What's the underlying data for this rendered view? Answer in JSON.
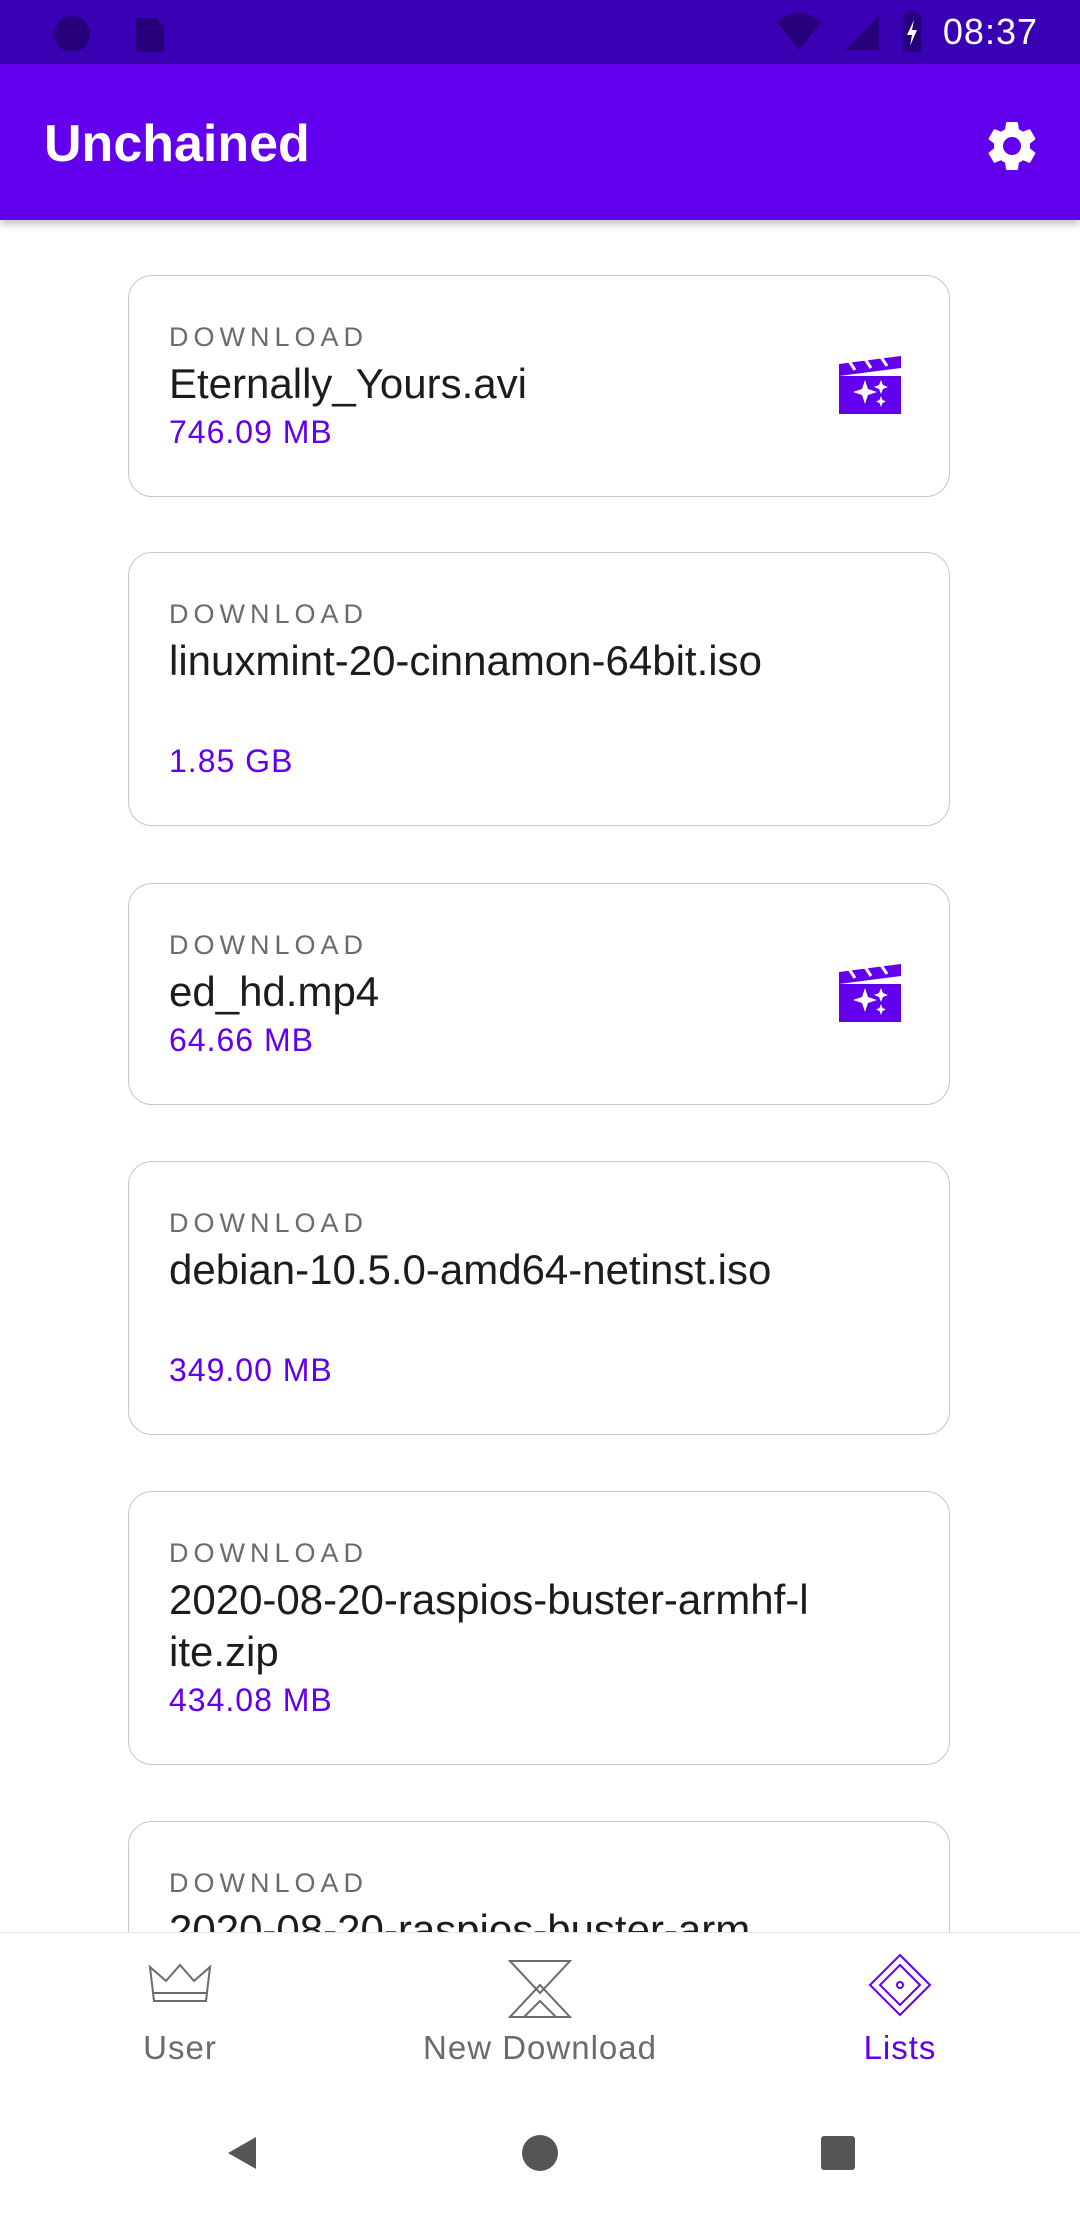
{
  "status_bar": {
    "time": "08:37"
  },
  "app_bar": {
    "title": "Unchained",
    "settings_icon": "gear-icon"
  },
  "downloads": [
    {
      "label": "DOWNLOAD",
      "name": "Eternally_Yours.avi",
      "size": "746.09 MB",
      "icon": "movie-icon"
    },
    {
      "label": "DOWNLOAD",
      "name": "linuxmint-20-cinnamon-64bit.iso",
      "size": "1.85 GB"
    },
    {
      "label": "DOWNLOAD",
      "name": "ed_hd.mp4",
      "size": "64.66 MB",
      "icon": "movie-icon"
    },
    {
      "label": "DOWNLOAD",
      "name": "debian-10.5.0-amd64-netinst.iso",
      "size": "349.00 MB"
    },
    {
      "label": "DOWNLOAD",
      "name": "2020-08-20-raspios-buster-armhf-lite.zip",
      "size": "434.08 MB"
    },
    {
      "label": "DOWNLOAD",
      "name": "2020-08-20-raspios-buster-arm"
    }
  ],
  "bottom_nav": {
    "items": [
      {
        "label": "User",
        "icon": "crown-icon",
        "active": false
      },
      {
        "label": "New Download",
        "icon": "hourglass-icon",
        "active": false
      },
      {
        "label": "Lists",
        "icon": "diamond-icon",
        "active": true
      }
    ]
  },
  "colors": {
    "primary": "#6200ee",
    "status_bar": "#3a00b3",
    "accent_text": "#6200ee"
  }
}
